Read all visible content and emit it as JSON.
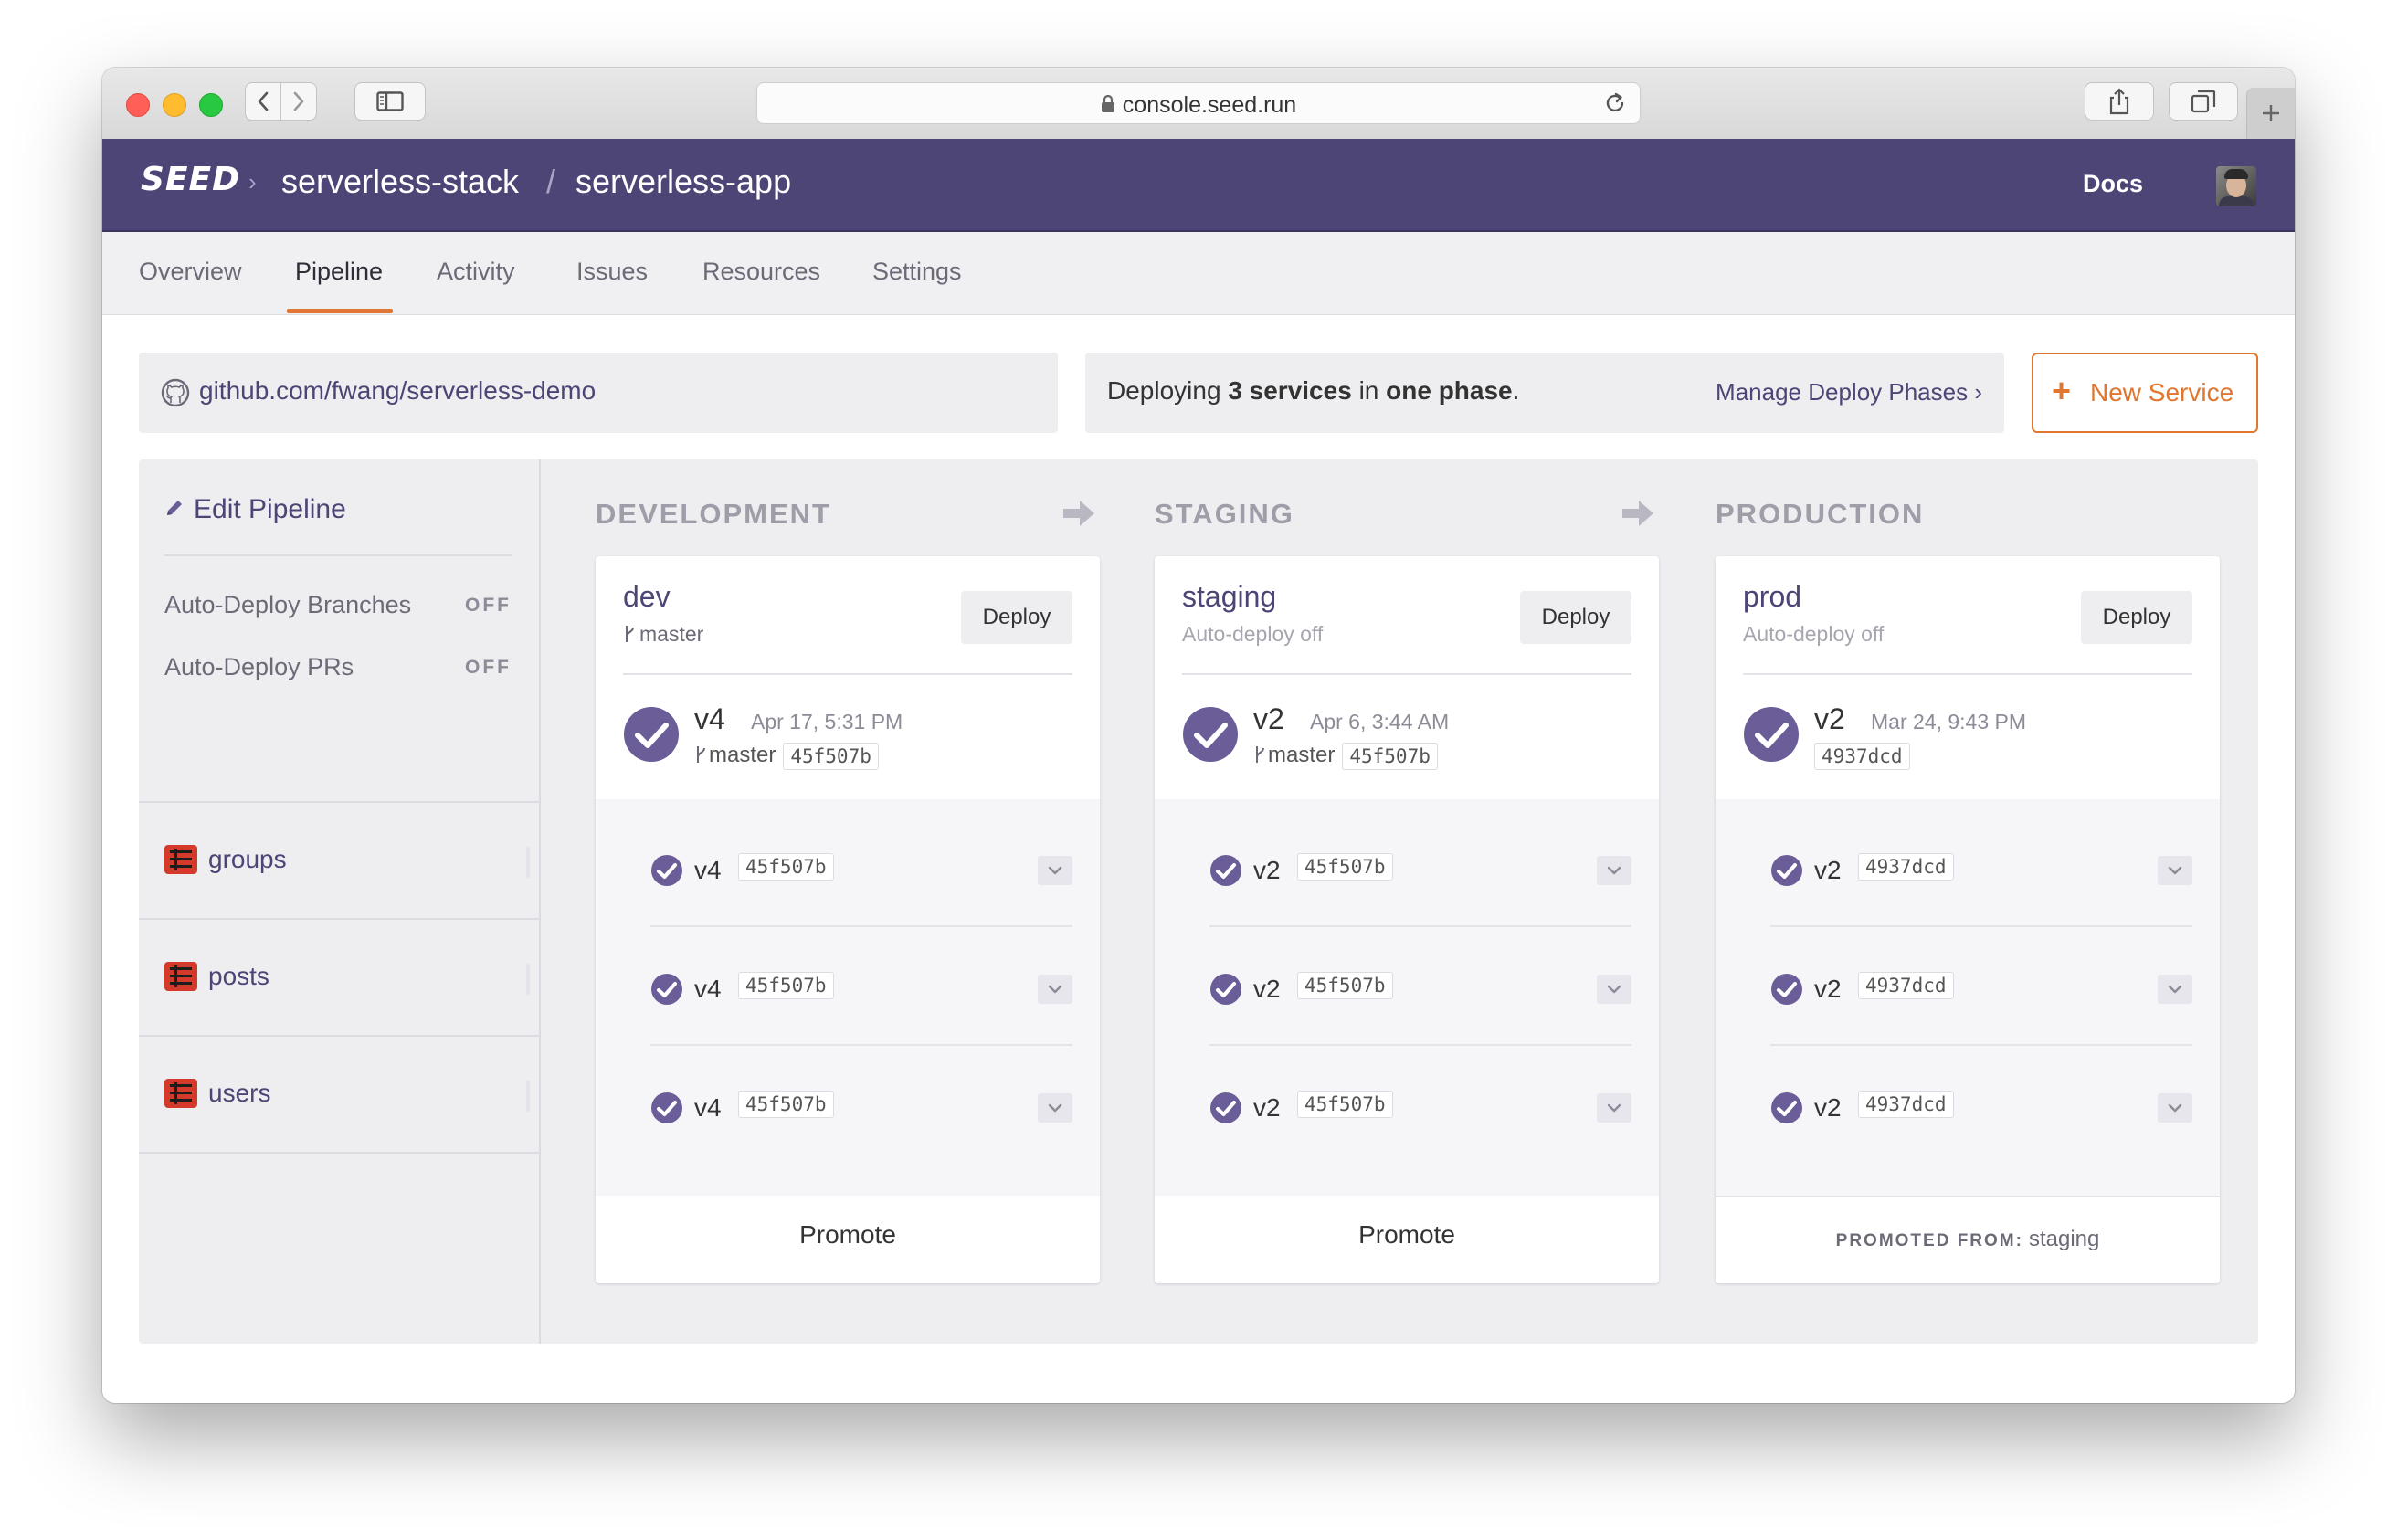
{
  "browser": {
    "url": "console.seed.run"
  },
  "header": {
    "logo": "SEED",
    "breadcrumb_sep": "›",
    "org": "serverless-stack",
    "slash": "/",
    "app": "serverless-app",
    "docs_label": "Docs"
  },
  "tabs": [
    {
      "label": "Overview",
      "active": false
    },
    {
      "label": "Pipeline",
      "active": true
    },
    {
      "label": "Activity",
      "active": false
    },
    {
      "label": "Issues",
      "active": false
    },
    {
      "label": "Resources",
      "active": false
    },
    {
      "label": "Settings",
      "active": false
    }
  ],
  "repo": {
    "link": "github.com/fwang/serverless-demo"
  },
  "deploy_info": {
    "prefix": "Deploying",
    "count": "3 services",
    "middle": "in",
    "phases": "one phase",
    "suffix": ".",
    "manage_link": "Manage Deploy Phases ›"
  },
  "new_service": {
    "plus": "+",
    "label": "New Service"
  },
  "sidebar": {
    "edit_pipeline": "Edit Pipeline",
    "settings": [
      {
        "label": "Auto-Deploy Branches",
        "value": "OFF"
      },
      {
        "label": "Auto-Deploy PRs",
        "value": "OFF"
      }
    ],
    "services": [
      {
        "name": "groups"
      },
      {
        "name": "posts"
      },
      {
        "name": "users"
      }
    ]
  },
  "stages": [
    {
      "title": "DEVELOPMENT",
      "name": "dev",
      "sub": "master",
      "sub_is_branch": true,
      "deploy_label": "Deploy",
      "build": {
        "version": "v4",
        "date": "Apr 17, 5:31 PM",
        "branch": "master",
        "commit": "45f507b"
      },
      "services": [
        {
          "version": "v4",
          "commit": "45f507b"
        },
        {
          "version": "v4",
          "commit": "45f507b"
        },
        {
          "version": "v4",
          "commit": "45f507b"
        }
      ],
      "promote_label": "Promote"
    },
    {
      "title": "STAGING",
      "name": "staging",
      "sub": "Auto-deploy off",
      "sub_is_branch": false,
      "deploy_label": "Deploy",
      "build": {
        "version": "v2",
        "date": "Apr 6, 3:44 AM",
        "branch": "master",
        "commit": "45f507b"
      },
      "services": [
        {
          "version": "v2",
          "commit": "45f507b"
        },
        {
          "version": "v2",
          "commit": "45f507b"
        },
        {
          "version": "v2",
          "commit": "45f507b"
        }
      ],
      "promote_label": "Promote"
    },
    {
      "title": "PRODUCTION",
      "name": "prod",
      "sub": "Auto-deploy off",
      "sub_is_branch": false,
      "deploy_label": "Deploy",
      "build": {
        "version": "v2",
        "date": "Mar 24, 9:43 PM",
        "branch": "",
        "commit": "4937dcd"
      },
      "services": [
        {
          "version": "v2",
          "commit": "4937dcd"
        },
        {
          "version": "v2",
          "commit": "4937dcd"
        },
        {
          "version": "v2",
          "commit": "4937dcd"
        }
      ],
      "promoted_from_label": "PROMOTED FROM:",
      "promoted_from": "staging"
    }
  ],
  "colors": {
    "header_bg": "#4c4575",
    "accent": "#e0762f",
    "link": "#4c4575",
    "success": "#6a5d98"
  },
  "icons": [
    "lock-icon",
    "reload-icon",
    "back-icon",
    "forward-icon",
    "sidebar-toggle-icon",
    "share-icon",
    "tabs-icon",
    "plus-icon",
    "github-icon",
    "pencil-icon",
    "service-icon",
    "branch-icon",
    "check-circle-icon",
    "chevron-down-icon",
    "arrow-right-icon"
  ]
}
